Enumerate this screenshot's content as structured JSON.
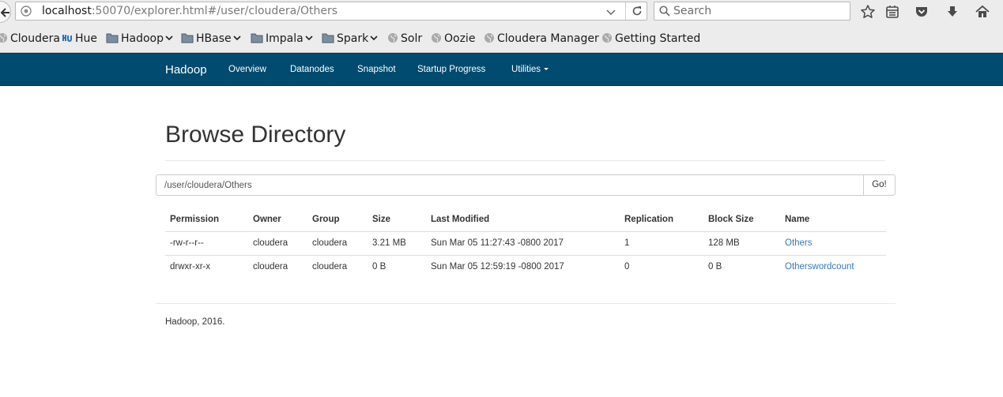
{
  "browser": {
    "url_host": "localhost",
    "url_path": ":50070/explorer.html#/user/cloudera/Others",
    "search_placeholder": "Search"
  },
  "bookmarks": [
    {
      "label": "Cloudera",
      "icon": "globe-icon",
      "has_menu": false
    },
    {
      "label": "Hue",
      "icon": "hue-icon",
      "has_menu": false
    },
    {
      "label": "Hadoop",
      "icon": "folder-icon",
      "has_menu": true
    },
    {
      "label": "HBase",
      "icon": "folder-icon",
      "has_menu": true
    },
    {
      "label": "Impala",
      "icon": "folder-icon",
      "has_menu": true
    },
    {
      "label": "Spark",
      "icon": "folder-icon",
      "has_menu": true
    },
    {
      "label": "Solr",
      "icon": "globe-icon",
      "has_menu": false
    },
    {
      "label": "Oozie",
      "icon": "globe-icon",
      "has_menu": false
    },
    {
      "label": "Cloudera Manager",
      "icon": "globe-icon",
      "has_menu": false
    },
    {
      "label": "Getting Started",
      "icon": "globe-icon",
      "has_menu": false
    }
  ],
  "navbar": {
    "brand": "Hadoop",
    "items": [
      "Overview",
      "Datanodes",
      "Snapshot",
      "Startup Progress",
      "Utilities"
    ]
  },
  "page": {
    "title": "Browse Directory",
    "path_value": "/user/cloudera/Others",
    "go_label": "Go!"
  },
  "table": {
    "headers": [
      "Permission",
      "Owner",
      "Group",
      "Size",
      "Last Modified",
      "Replication",
      "Block Size",
      "Name"
    ],
    "rows": [
      [
        "-rw-r--r--",
        "cloudera",
        "cloudera",
        "3.21 MB",
        "Sun Mar 05 11:27:43 -0800 2017",
        "1",
        "128 MB",
        "Others"
      ],
      [
        "drwxr-xr-x",
        "cloudera",
        "cloudera",
        "0 B",
        "Sun Mar 05 12:59:19 -0800 2017",
        "0",
        "0 B",
        "Otherswordcount"
      ]
    ]
  },
  "footer": "Hadoop, 2016.",
  "colors": {
    "navbar": "#004b6f",
    "link": "#337ab7"
  }
}
